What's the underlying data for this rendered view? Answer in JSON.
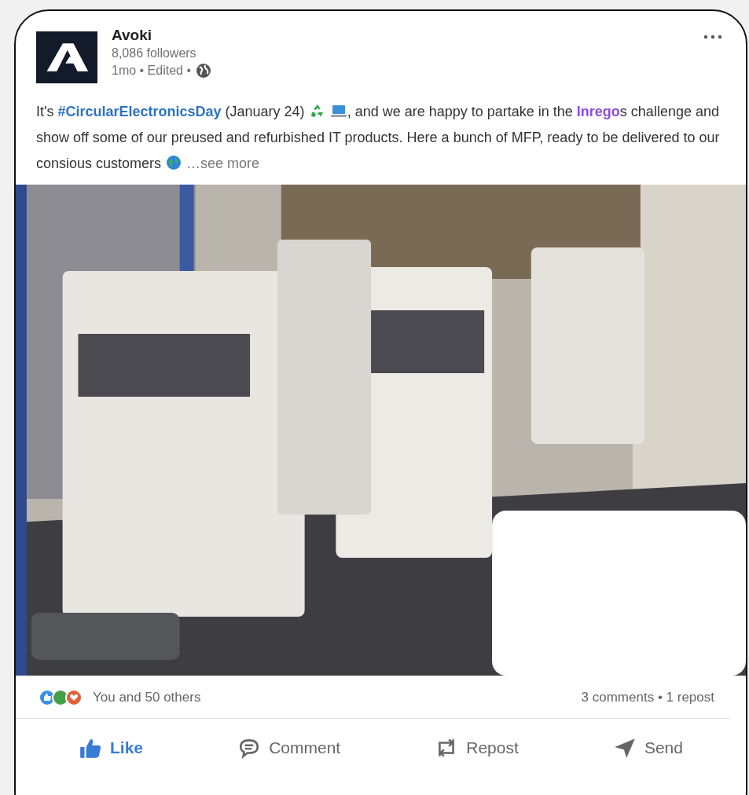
{
  "post": {
    "author": "Avoki",
    "followers": "8,086 followers",
    "meta": "1mo • Edited •",
    "body": {
      "part_1": "It's ",
      "hashtag": "#CircularElectronicsDay",
      "part_2": " (January 24) ",
      "part_3": ", and we are happy to partake in the ",
      "mention": "Inrego",
      "part_4": "s challenge and show off some of our preused and refurbished IT products. Here a bunch of MFP, ready to be delivered to our consious customers ",
      "see_more": "…see more"
    },
    "reactions": "You and 50 others",
    "stats": "3 comments • 1 repost",
    "actions": [
      {
        "label": "Like",
        "selected": true
      },
      {
        "label": "Comment",
        "selected": false
      },
      {
        "label": "Repost",
        "selected": false
      },
      {
        "label": "Send",
        "selected": false
      }
    ]
  }
}
